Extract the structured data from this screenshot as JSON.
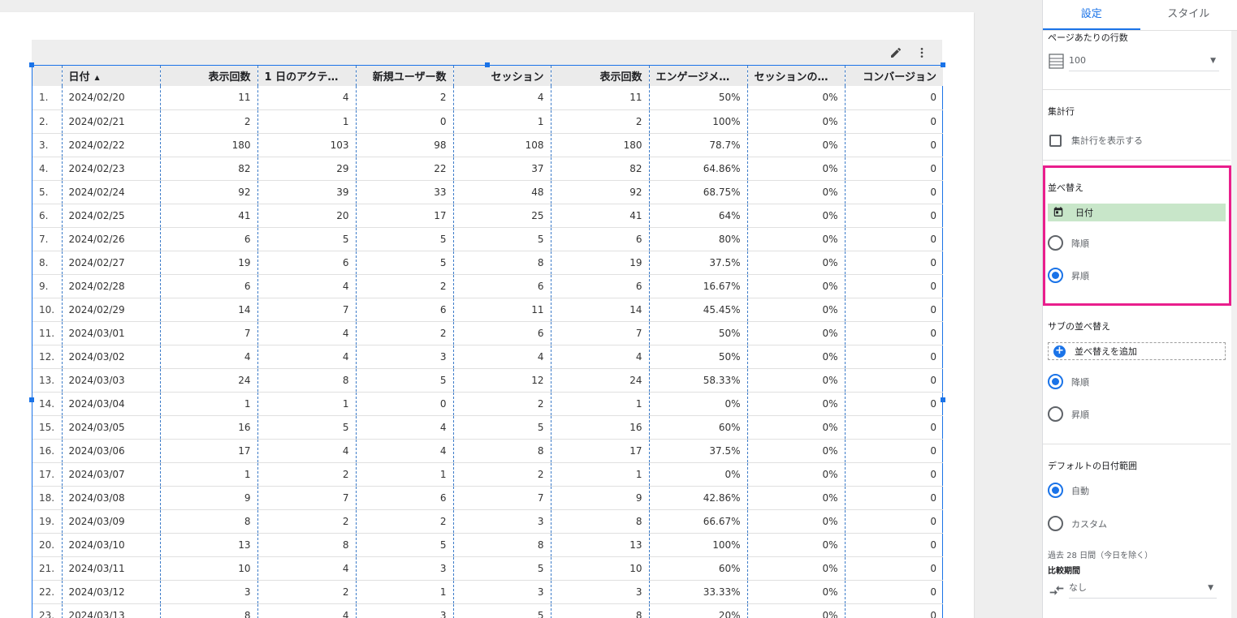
{
  "table": {
    "columns": [
      {
        "label": "",
        "align": "txt"
      },
      {
        "label": "日付",
        "align": "txt",
        "sort_icon": "sort-ascending-icon"
      },
      {
        "label": "表示回数",
        "align": "num"
      },
      {
        "label": "1 日のアクテ…",
        "align": "txt"
      },
      {
        "label": "新規ユーザー数",
        "align": "num"
      },
      {
        "label": "セッション",
        "align": "num"
      },
      {
        "label": "表示回数",
        "align": "num"
      },
      {
        "label": "エンゲージメ…",
        "align": "txt"
      },
      {
        "label": "セッションの…",
        "align": "txt"
      },
      {
        "label": "コンバージョン",
        "align": "num"
      }
    ],
    "rows": [
      [
        "1.",
        "2024/02/20",
        "11",
        "4",
        "2",
        "4",
        "11",
        "50%",
        "0%",
        "0"
      ],
      [
        "2.",
        "2024/02/21",
        "2",
        "1",
        "0",
        "1",
        "2",
        "100%",
        "0%",
        "0"
      ],
      [
        "3.",
        "2024/02/22",
        "180",
        "103",
        "98",
        "108",
        "180",
        "78.7%",
        "0%",
        "0"
      ],
      [
        "4.",
        "2024/02/23",
        "82",
        "29",
        "22",
        "37",
        "82",
        "64.86%",
        "0%",
        "0"
      ],
      [
        "5.",
        "2024/02/24",
        "92",
        "39",
        "33",
        "48",
        "92",
        "68.75%",
        "0%",
        "0"
      ],
      [
        "6.",
        "2024/02/25",
        "41",
        "20",
        "17",
        "25",
        "41",
        "64%",
        "0%",
        "0"
      ],
      [
        "7.",
        "2024/02/26",
        "6",
        "5",
        "5",
        "5",
        "6",
        "80%",
        "0%",
        "0"
      ],
      [
        "8.",
        "2024/02/27",
        "19",
        "6",
        "5",
        "8",
        "19",
        "37.5%",
        "0%",
        "0"
      ],
      [
        "9.",
        "2024/02/28",
        "6",
        "4",
        "2",
        "6",
        "6",
        "16.67%",
        "0%",
        "0"
      ],
      [
        "10.",
        "2024/02/29",
        "14",
        "7",
        "6",
        "11",
        "14",
        "45.45%",
        "0%",
        "0"
      ],
      [
        "11.",
        "2024/03/01",
        "7",
        "4",
        "2",
        "6",
        "7",
        "50%",
        "0%",
        "0"
      ],
      [
        "12.",
        "2024/03/02",
        "4",
        "4",
        "3",
        "4",
        "4",
        "50%",
        "0%",
        "0"
      ],
      [
        "13.",
        "2024/03/03",
        "24",
        "8",
        "5",
        "12",
        "24",
        "58.33%",
        "0%",
        "0"
      ],
      [
        "14.",
        "2024/03/04",
        "1",
        "1",
        "0",
        "2",
        "1",
        "0%",
        "0%",
        "0"
      ],
      [
        "15.",
        "2024/03/05",
        "16",
        "5",
        "4",
        "5",
        "16",
        "60%",
        "0%",
        "0"
      ],
      [
        "16.",
        "2024/03/06",
        "17",
        "4",
        "4",
        "8",
        "17",
        "37.5%",
        "0%",
        "0"
      ],
      [
        "17.",
        "2024/03/07",
        "1",
        "2",
        "1",
        "2",
        "1",
        "0%",
        "0%",
        "0"
      ],
      [
        "18.",
        "2024/03/08",
        "9",
        "7",
        "6",
        "7",
        "9",
        "42.86%",
        "0%",
        "0"
      ],
      [
        "19.",
        "2024/03/09",
        "8",
        "2",
        "2",
        "3",
        "8",
        "66.67%",
        "0%",
        "0"
      ],
      [
        "20.",
        "2024/03/10",
        "13",
        "8",
        "5",
        "8",
        "13",
        "100%",
        "0%",
        "0"
      ],
      [
        "21.",
        "2024/03/11",
        "10",
        "4",
        "3",
        "5",
        "10",
        "60%",
        "0%",
        "0"
      ],
      [
        "22.",
        "2024/03/12",
        "3",
        "2",
        "1",
        "3",
        "3",
        "33.33%",
        "0%",
        "0"
      ],
      [
        "23.",
        "2024/03/13",
        "8",
        "4",
        "3",
        "5",
        "8",
        "20%",
        "0%",
        "0"
      ]
    ],
    "header_icons": [
      "pencil-icon",
      "more-vert-icon"
    ]
  },
  "panel": {
    "tabs": [
      "設定",
      "スタイル"
    ],
    "active_tab": "設定",
    "rows_per_page": {
      "label": "ページあたりの行数",
      "value": "100",
      "icon": "table-rows-icon"
    },
    "summary": {
      "label": "集計行",
      "checkbox_label": "集計行を表示する",
      "checked": false
    },
    "sort": {
      "label": "並べ替え",
      "field": "日付",
      "field_icon": "calendar-icon",
      "desc": "降順",
      "asc": "昇順",
      "selected": "asc"
    },
    "sub_sort": {
      "label": "サブの並べ替え",
      "add": "並べ替えを追加",
      "desc": "降順",
      "asc": "昇順",
      "selected": "desc"
    },
    "date_range": {
      "label": "デフォルトの日付範囲",
      "auto": "自動",
      "custom": "カスタム",
      "selected": "auto",
      "note": "過去 28 日間（今日を除く）"
    },
    "compare": {
      "label": "比較期間",
      "value": "なし",
      "icon": "compare-arrows-icon"
    }
  },
  "colors": {
    "accent": "#1a73e8",
    "highlight": "#e91e8c",
    "chip": "#c8e6c9"
  }
}
